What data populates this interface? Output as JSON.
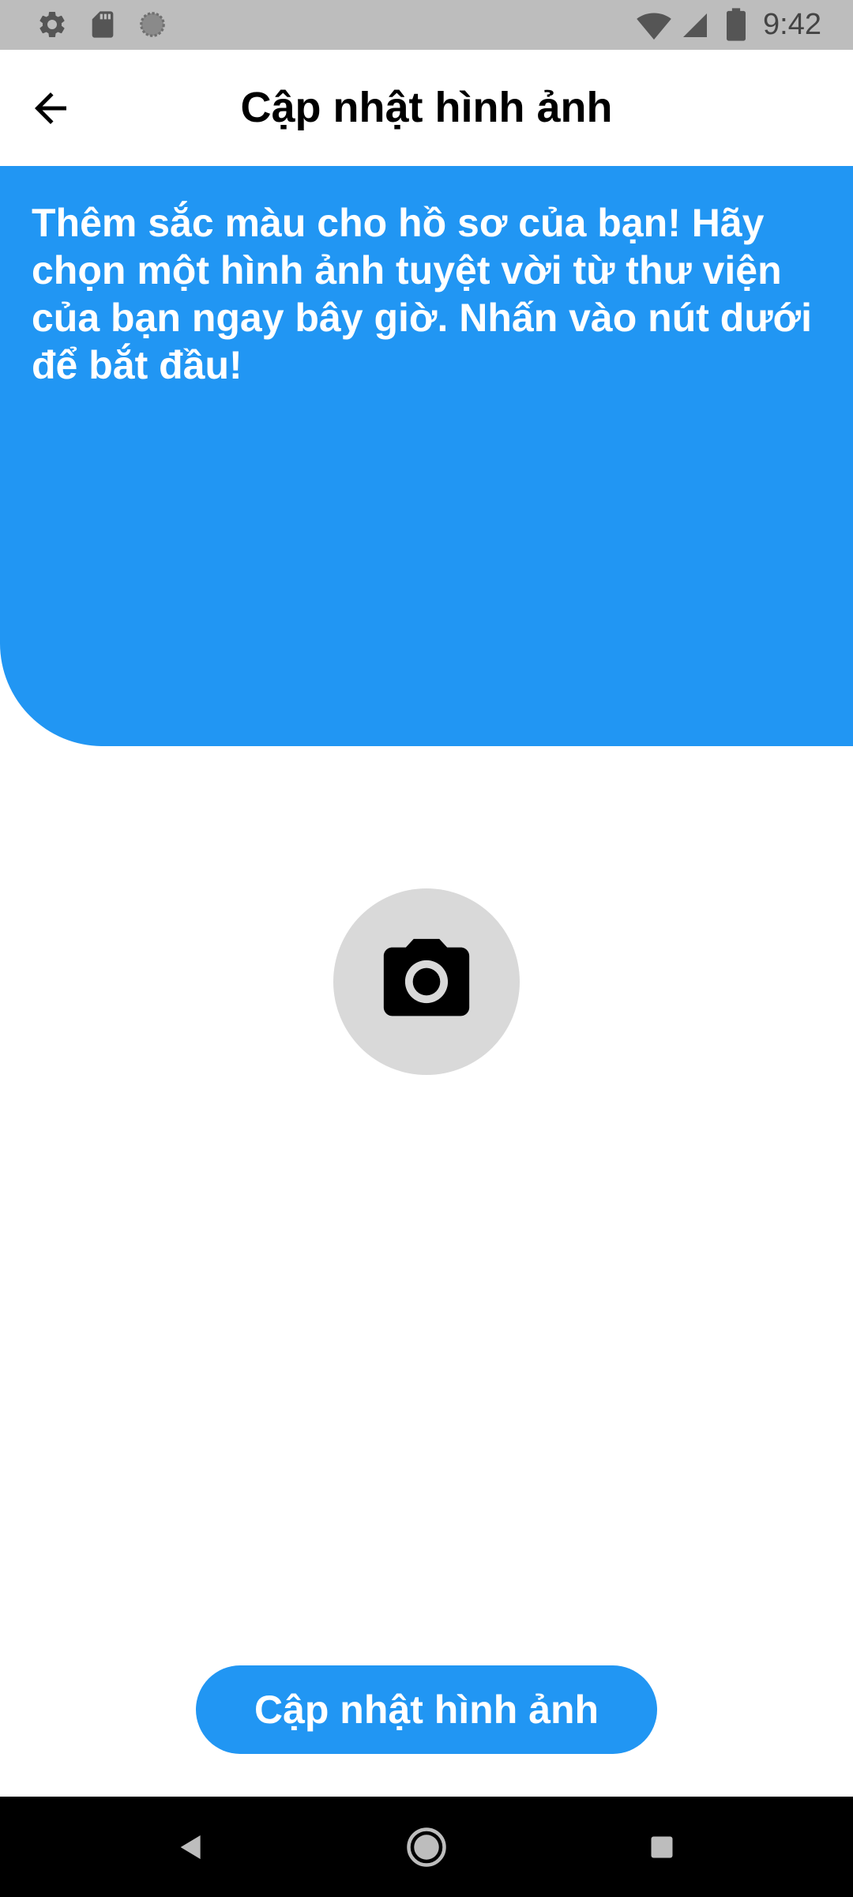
{
  "status_bar": {
    "time": "9:42",
    "icons": [
      "settings-icon",
      "sd-card-icon",
      "circle-status-icon",
      "wifi-icon",
      "cell-signal-icon",
      "battery-icon"
    ]
  },
  "app_bar": {
    "title": "Cập nhật hình ảnh",
    "back_icon": "arrow-back-icon"
  },
  "banner": {
    "text": "Thêm sắc màu cho hồ sơ của bạn! Hãy chọn một hình ảnh tuyệt vời từ thư viện của bạn ngay bây giờ. Nhấn vào nút dưới để bắt đầu!"
  },
  "camera": {
    "icon": "camera-icon"
  },
  "update_button": {
    "label": "Cập nhật hình ảnh"
  },
  "nav_bar": {
    "icons": [
      "nav-back-icon",
      "nav-home-icon",
      "nav-recents-icon"
    ]
  },
  "colors": {
    "accent": "#2196f3",
    "status_bar": "#bdbdbd",
    "camera_circle": "#d9d9d9",
    "nav_bar": "#000000"
  }
}
